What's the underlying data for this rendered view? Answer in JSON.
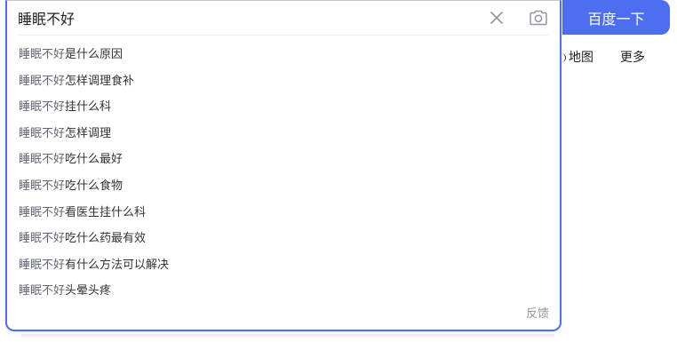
{
  "search": {
    "query": "睡眠不好",
    "button_label": "百度一下"
  },
  "nav": {
    "map_label": "地图",
    "more_label": "更多"
  },
  "suggestions": {
    "prefix": "睡眠不好",
    "items": [
      {
        "rest": "是什么原因"
      },
      {
        "rest": "怎样调理食补"
      },
      {
        "rest": "挂什么科"
      },
      {
        "rest": "怎样调理"
      },
      {
        "rest": "吃什么最好"
      },
      {
        "rest": "吃什么食物"
      },
      {
        "rest": "看医生挂什么科"
      },
      {
        "rest": "吃什么药最有效"
      },
      {
        "rest": "有什么方法可以解决"
      },
      {
        "rest": "头晕头疼"
      }
    ],
    "feedback_label": "反馈"
  },
  "colors": {
    "accent": "#4e6ef2",
    "suggest_prefix": "#626675",
    "suggest_text": "#333333",
    "muted": "#9195a3"
  },
  "icons": {
    "clear": "close-icon",
    "camera": "camera-icon"
  }
}
